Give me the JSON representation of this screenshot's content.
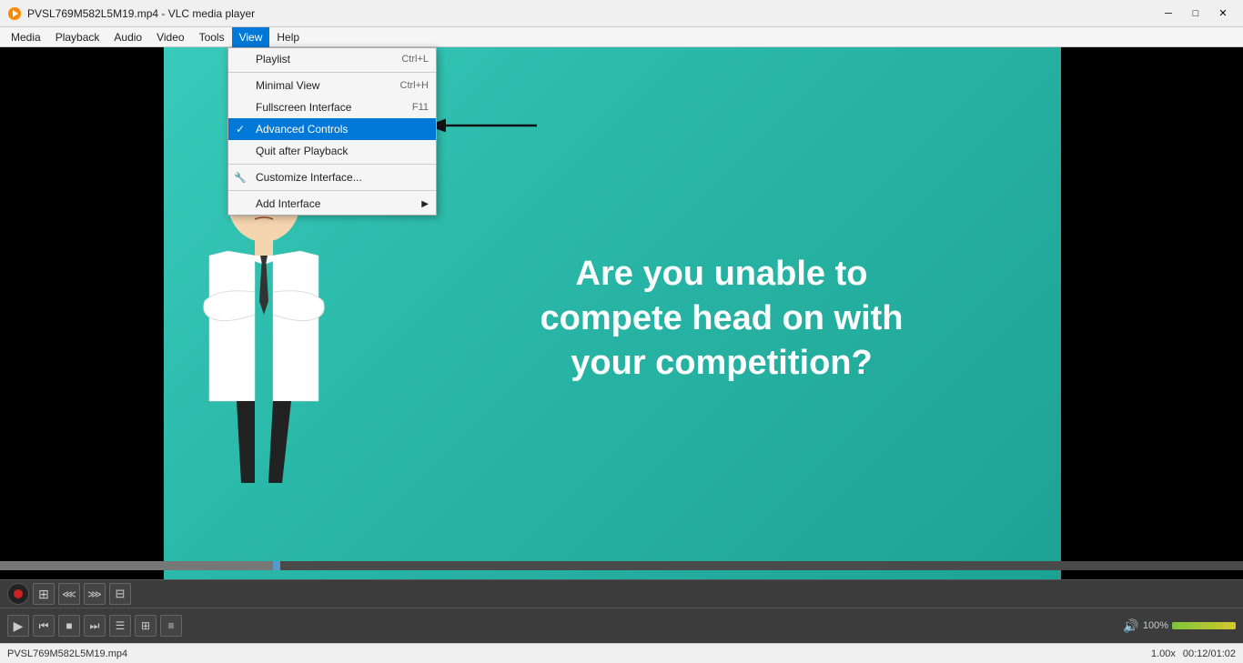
{
  "titlebar": {
    "title": "PVSL769M582L5M19.mp4 - VLC media player",
    "icon": "▶",
    "minimize_label": "─",
    "maximize_label": "□",
    "close_label": "✕"
  },
  "menubar": {
    "items": [
      {
        "label": "Media",
        "id": "media"
      },
      {
        "label": "Playback",
        "id": "playback"
      },
      {
        "label": "Audio",
        "id": "audio"
      },
      {
        "label": "Video",
        "id": "video"
      },
      {
        "label": "Tools",
        "id": "tools"
      },
      {
        "label": "View",
        "id": "view",
        "active": true
      },
      {
        "label": "Help",
        "id": "help"
      }
    ]
  },
  "view_menu": {
    "items": [
      {
        "label": "Playlist",
        "shortcut": "Ctrl+L",
        "type": "item",
        "id": "playlist"
      },
      {
        "label": "separator1",
        "type": "separator"
      },
      {
        "label": "Minimal View",
        "shortcut": "Ctrl+H",
        "type": "item",
        "id": "minimal-view"
      },
      {
        "label": "Fullscreen Interface",
        "shortcut": "F11",
        "type": "item",
        "id": "fullscreen"
      },
      {
        "label": "Advanced Controls",
        "shortcut": "",
        "type": "item",
        "id": "advanced-controls",
        "checked": true,
        "highlighted": true
      },
      {
        "label": "Quit after Playback",
        "shortcut": "",
        "type": "item",
        "id": "quit-after"
      },
      {
        "label": "separator2",
        "type": "separator"
      },
      {
        "label": "Customize Interface...",
        "shortcut": "",
        "type": "item",
        "id": "customize",
        "icon": "wrench"
      },
      {
        "label": "separator3",
        "type": "separator"
      },
      {
        "label": "Add Interface",
        "shortcut": "",
        "type": "item",
        "id": "add-interface",
        "arrow": true
      }
    ]
  },
  "video": {
    "text_line1": "Are you unable to",
    "text_line2": "compete head on with",
    "text_line3": "your competition?"
  },
  "controls": {
    "row1_buttons": [
      "rec",
      "frame-step",
      "prev-bookmark",
      "next-bookmark",
      "loop"
    ],
    "row2_buttons": [
      "play",
      "prev",
      "stop",
      "next",
      "toggle-playlist",
      "extended",
      "equalizer"
    ],
    "volume_label": "100%",
    "time_current": "00:12",
    "time_total": "01:02",
    "speed": "1.00x"
  },
  "statusbar": {
    "filename": "PVSL769M582L5M19.mp4",
    "speed": "1.00x",
    "time": "00:12/01:02"
  }
}
